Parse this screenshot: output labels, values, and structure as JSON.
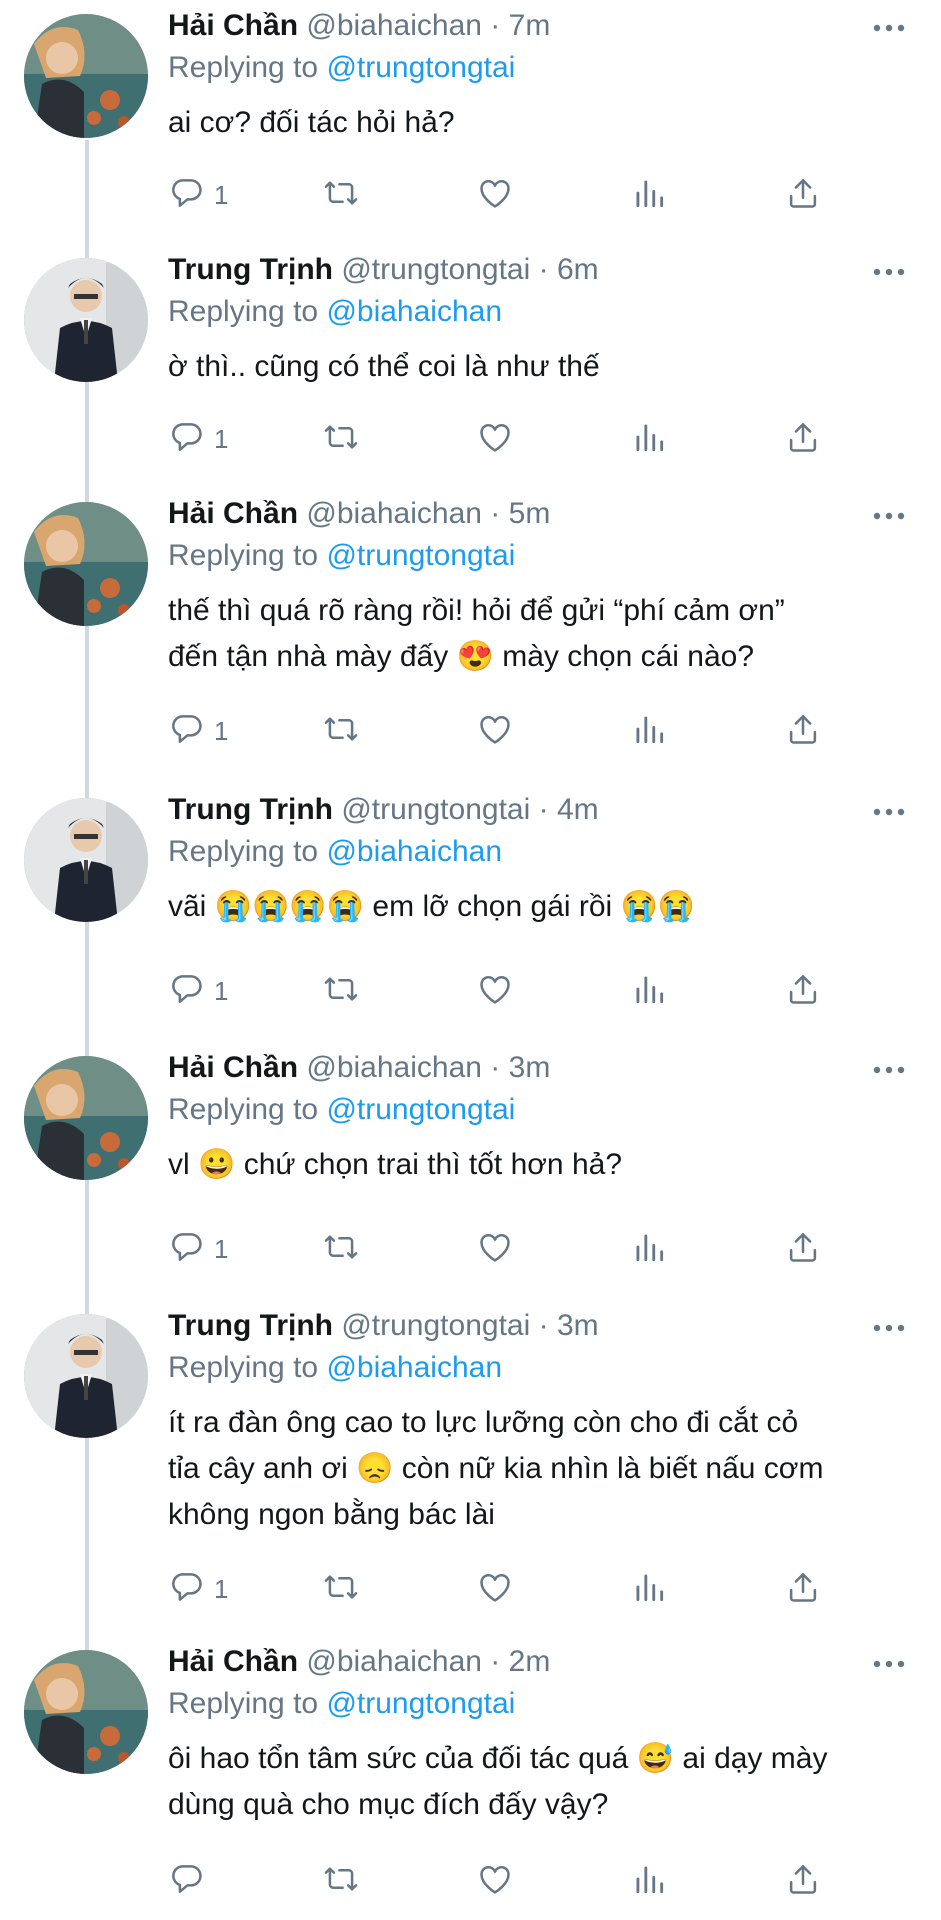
{
  "colors": {
    "accent": "#1d9bf0",
    "secondary_text": "#657786",
    "thread_line": "#cfd9de"
  },
  "tweets": [
    {
      "name": "Hải Chần",
      "handle": "@biahaichan",
      "dot": "·",
      "time": "7m",
      "reply_prefix": "Replying to",
      "reply_to": "@trungtongtai",
      "text": "ai cơ? đối tác hỏi hả?",
      "reply_count": "1",
      "avatar": "avatar-hai"
    },
    {
      "name": "Trung Trịnh",
      "handle": "@trungtongtai",
      "dot": "·",
      "time": "6m",
      "reply_prefix": "Replying to",
      "reply_to": "@biahaichan",
      "text": "ờ thì.. cũng có thể coi là như thế",
      "reply_count": "1",
      "avatar": "avatar-trung"
    },
    {
      "name": "Hải Chần",
      "handle": "@biahaichan",
      "dot": "·",
      "time": "5m",
      "reply_prefix": "Replying to",
      "reply_to": "@trungtongtai",
      "text": "thế thì quá rõ ràng rồi! hỏi để gửi “phí cảm ơn”\nđến tận nhà mày đấy 😍  mày chọn cái nào?",
      "reply_count": "1",
      "avatar": "avatar-hai"
    },
    {
      "name": "Trung Trịnh",
      "handle": "@trungtongtai",
      "dot": "·",
      "time": "4m",
      "reply_prefix": "Replying to",
      "reply_to": "@biahaichan",
      "text": "vãi 😭😭😭😭  em lỡ chọn gái rồi 😭😭",
      "reply_count": "1",
      "avatar": "avatar-trung"
    },
    {
      "name": "Hải Chần",
      "handle": "@biahaichan",
      "dot": "·",
      "time": "3m",
      "reply_prefix": "Replying to",
      "reply_to": "@trungtongtai",
      "text": "vl 😀  chứ chọn trai thì tốt hơn hả?",
      "reply_count": "1",
      "avatar": "avatar-hai"
    },
    {
      "name": "Trung Trịnh",
      "handle": "@trungtongtai",
      "dot": "·",
      "time": "3m",
      "reply_prefix": "Replying to",
      "reply_to": "@biahaichan",
      "text": "ít ra đàn ông cao to lực lưỡng còn cho đi cắt cỏ\ntỉa cây anh ơi 😞  còn nữ kia nhìn là biết nấu cơm\nkhông ngon bằng bác lài",
      "reply_count": "1",
      "avatar": "avatar-trung"
    },
    {
      "name": "Hải Chần",
      "handle": "@biahaichan",
      "dot": "·",
      "time": "2m",
      "reply_prefix": "Replying to",
      "reply_to": "@trungtongtai",
      "text": "ôi hao tổn tâm sức của đối tác quá 😅  ai dạy mày\ndùng quà cho mục đích đấy vậy?",
      "reply_count": "",
      "avatar": "avatar-hai"
    }
  ]
}
